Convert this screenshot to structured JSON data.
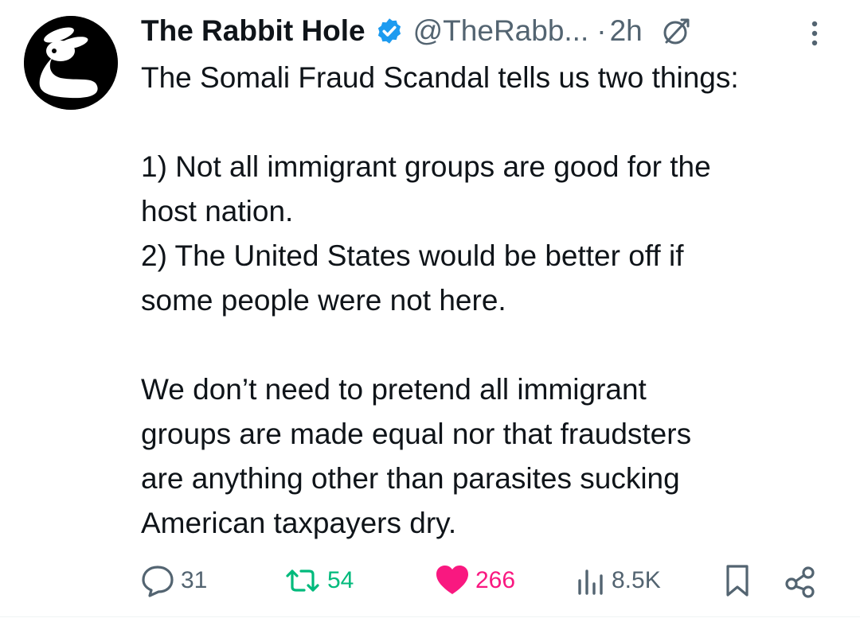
{
  "tweet": {
    "author_name": "The Rabbit Hole",
    "handle": "@TheRabb...",
    "separator": "·",
    "time": "2h",
    "lines": [
      "The Somali Fraud Scandal tells us two things:",
      "",
      "1) Not all immigrant groups are good for the",
      "host nation.",
      "2) The United States would be better off if",
      "some people were not here.",
      "",
      "We don’t need to pretend all immigrant",
      "groups are made equal nor that fraudsters",
      "are anything other than parasites sucking",
      "American taxpayers dry."
    ]
  },
  "actions": {
    "replies": "31",
    "reposts": "54",
    "likes": "266",
    "views": "8.5K"
  },
  "icons": {
    "avatar": "rabbit-logo",
    "verified": "verified-badge-icon",
    "grok": "grok-icon",
    "more": "more-vertical-icon",
    "reply": "reply-icon",
    "repost": "repost-icon",
    "like": "heart-icon",
    "views": "views-icon",
    "bookmark": "bookmark-icon",
    "share": "share-icon"
  },
  "colors": {
    "text": "#0f1419",
    "secondary": "#536471",
    "verified": "#1d9bf0",
    "repost_active": "#00ba7c",
    "like_active": "#f91880"
  }
}
